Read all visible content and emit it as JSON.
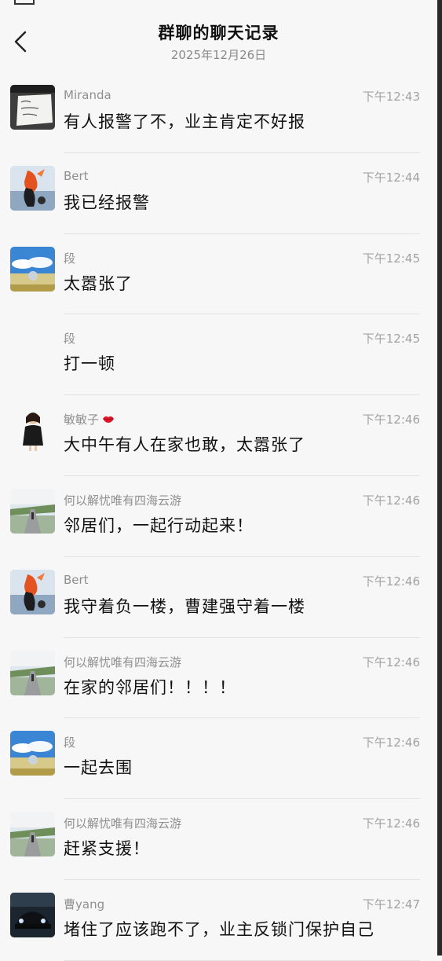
{
  "header": {
    "title": "群聊的聊天记录",
    "date": "2025年12月26日"
  },
  "messages": [
    {
      "name": "Miranda",
      "time": "下午12:43",
      "text": "有人报警了不，业主肯定不好报",
      "avatar": "note-photo"
    },
    {
      "name": "Bert",
      "time": "下午12:44",
      "text": "我已经报警",
      "avatar": "goldfish"
    },
    {
      "name": "段",
      "time": "下午12:45",
      "text": "太嚣张了",
      "avatar": "sky-landscape"
    },
    {
      "name": "段",
      "time": "下午12:45",
      "text": "打一顿",
      "avatar": ""
    },
    {
      "name": "敏敏子",
      "time": "下午12:46",
      "text": "大中午有人在家也敢，太嚣张了",
      "avatar": "girl-portrait"
    },
    {
      "name": "何以解忧唯有四海云游",
      "time": "下午12:46",
      "text": "邻居们，一起行动起来！",
      "avatar": "road-traveler"
    },
    {
      "name": "Bert",
      "time": "下午12:46",
      "text": "我守着负一楼，曹建强守着一楼",
      "avatar": "goldfish"
    },
    {
      "name": "何以解忧唯有四海云游",
      "time": "下午12:46",
      "text": "在家的邻居们！！！！",
      "avatar": "road-traveler"
    },
    {
      "name": "段",
      "time": "下午12:46",
      "text": "一起去围",
      "avatar": "sky-landscape"
    },
    {
      "name": "何以解忧唯有四海云游",
      "time": "下午12:46",
      "text": "赶紧支援！",
      "avatar": "road-traveler"
    },
    {
      "name": "曹yang",
      "time": "下午12:47",
      "text": "堵住了应该跑不了，业主反锁门保护自己",
      "avatar": "dark-car"
    }
  ]
}
